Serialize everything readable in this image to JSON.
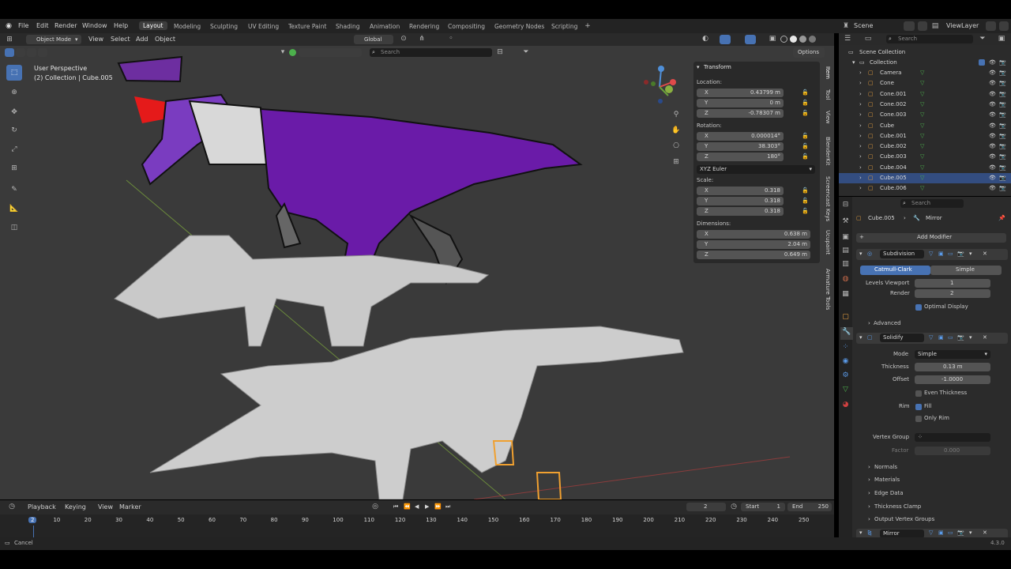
{
  "menus": [
    "File",
    "Edit",
    "Render",
    "Window",
    "Help"
  ],
  "workspaces": [
    "Layout",
    "Modeling",
    "Sculpting",
    "UV Editing",
    "Texture Paint",
    "Shading",
    "Animation",
    "Rendering",
    "Compositing",
    "Geometry Nodes",
    "Scripting"
  ],
  "active_workspace": "Layout",
  "scene_label": "Scene",
  "view_layer_label": "ViewLayer",
  "header": {
    "mode": "Object Mode",
    "view_menus": [
      "View",
      "Select",
      "Add",
      "Object"
    ],
    "orientation": "Global",
    "options": "Options",
    "search_placeholder": "Search"
  },
  "viewport_info": {
    "perspective": "User Perspective",
    "collection": "(2) Collection | Cube.005"
  },
  "n_panel": {
    "title": "Transform",
    "location_label": "Location:",
    "location": [
      {
        "axis": "X",
        "value": "0.43799 m"
      },
      {
        "axis": "Y",
        "value": "0 m"
      },
      {
        "axis": "Z",
        "value": "-0.78307 m"
      }
    ],
    "rotation_label": "Rotation:",
    "rotation": [
      {
        "axis": "X",
        "value": "0.000014°"
      },
      {
        "axis": "Y",
        "value": "38.303°"
      },
      {
        "axis": "Z",
        "value": "180°"
      }
    ],
    "rotation_mode": "XYZ Euler",
    "scale_label": "Scale:",
    "scale": [
      {
        "axis": "X",
        "value": "0.318"
      },
      {
        "axis": "Y",
        "value": "0.318"
      },
      {
        "axis": "Z",
        "value": "0.318"
      }
    ],
    "dimensions_label": "Dimensions:",
    "dimensions": [
      {
        "axis": "X",
        "value": "0.638 m"
      },
      {
        "axis": "Y",
        "value": "2.04 m"
      },
      {
        "axis": "Z",
        "value": "0.649 m"
      }
    ]
  },
  "side_tabs": [
    "Item",
    "Tool",
    "View",
    "BlenderKit",
    "Screencast Keys",
    "Ucupaint",
    "Armature Tools"
  ],
  "outliner": {
    "search_placeholder": "Search",
    "root": "Scene Collection",
    "collection": "Collection",
    "items": [
      "Camera",
      "Cone",
      "Cone.001",
      "Cone.002",
      "Cone.003",
      "Cube",
      "Cube.001",
      "Cube.002",
      "Cube.003",
      "Cube.004",
      "Cube.005",
      "Cube.006"
    ],
    "selected": "Cube.005"
  },
  "properties": {
    "search_placeholder": "Search",
    "breadcrumb_object": "Cube.005",
    "breadcrumb_modifier": "Mirror",
    "add_modifier": "Add Modifier",
    "subdivision": {
      "name": "Subdivision",
      "type_a": "Catmull-Clark",
      "type_b": "Simple",
      "levels_viewport_label": "Levels Viewport",
      "levels_viewport": "1",
      "render_label": "Render",
      "render": "2",
      "optimal_display": "Optimal Display",
      "advanced": "Advanced"
    },
    "solidify": {
      "name": "Solidify",
      "mode_label": "Mode",
      "mode": "Simple",
      "thickness_label": "Thickness",
      "thickness": "0.13 m",
      "offset_label": "Offset",
      "offset": "-1.0000",
      "even_thickness": "Even Thickness",
      "rim_label": "Rim",
      "fill": "Fill",
      "only_rim": "Only Rim",
      "vertex_group_label": "Vertex Group",
      "factor_label": "Factor",
      "factor": "0.000",
      "subpanels": [
        "Normals",
        "Materials",
        "Edge Data",
        "Thickness Clamp",
        "Output Vertex Groups"
      ]
    },
    "mirror": {
      "name": "Mirror"
    }
  },
  "timeline": {
    "menus": [
      "Playback",
      "Keying",
      "View",
      "Marker"
    ],
    "current_frame": "2",
    "start_label": "Start",
    "start": "1",
    "end_label": "End",
    "end": "250",
    "ruler": [
      "2",
      "10",
      "20",
      "30",
      "40",
      "50",
      "60",
      "70",
      "80",
      "90",
      "100",
      "110",
      "120",
      "130",
      "140",
      "150",
      "160",
      "170",
      "180",
      "190",
      "200",
      "210",
      "220",
      "230",
      "240",
      "250"
    ]
  },
  "status": {
    "left": "Cancel",
    "version": "4.3.0"
  }
}
